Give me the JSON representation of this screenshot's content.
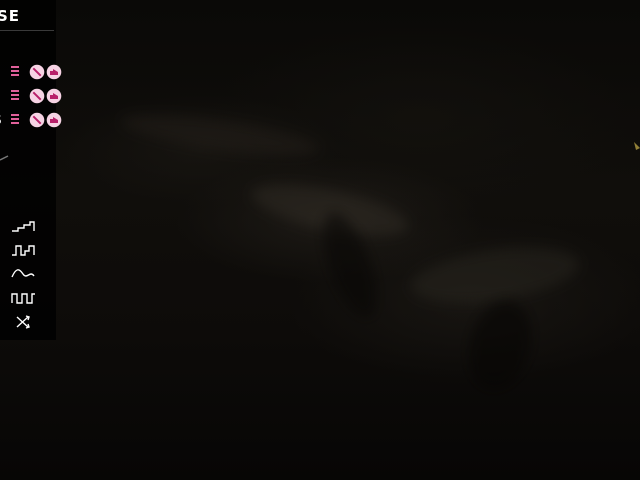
{
  "app": {
    "title_fragment": "SE"
  },
  "colors": {
    "accent": "#e0609a",
    "icon_fill": "#f6d3e4",
    "text": "#ffffff",
    "background": "#060504"
  },
  "tracks": [
    {
      "label": "",
      "icons": [
        "list-icon",
        "mute-icon",
        "sample-icon"
      ]
    },
    {
      "label": "",
      "icons": [
        "list-icon",
        "mute-icon",
        "sample-icon"
      ]
    },
    {
      "label": "S",
      "icons": [
        "list-icon",
        "mute-icon",
        "sample-icon"
      ]
    }
  ],
  "waveforms": [
    {
      "name": "sawtooth-wave-icon"
    },
    {
      "name": "square-step-wave-icon"
    },
    {
      "name": "sine-wave-icon"
    },
    {
      "name": "square-wave-icon"
    },
    {
      "name": "shuffle-icon"
    }
  ]
}
